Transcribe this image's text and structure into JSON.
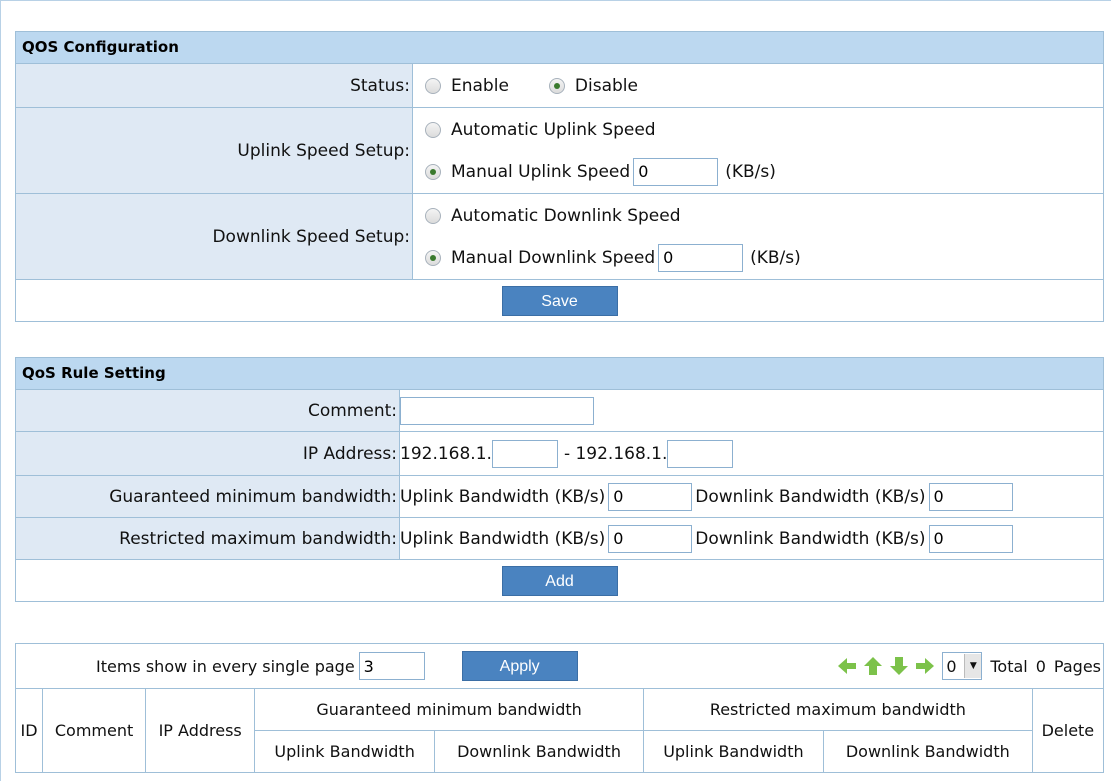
{
  "qos": {
    "title": "QOS Configuration",
    "status_label": "Status:",
    "enable": "Enable",
    "disable": "Disable",
    "uplink_label": "Uplink Speed Setup:",
    "auto_uplink": "Automatic Uplink Speed",
    "manual_uplink": "Manual Uplink Speed",
    "uplink_value": "0",
    "uplink_unit": "(KB/s)",
    "downlink_label": "Downlink Speed Setup:",
    "auto_downlink": "Automatic Downlink Speed",
    "manual_downlink": "Manual Downlink Speed",
    "downlink_value": "0",
    "downlink_unit": "(KB/s)",
    "save": "Save"
  },
  "rule": {
    "title": "QoS Rule Setting",
    "comment_label": "Comment:",
    "comment_value": "",
    "ip_label": "IP Address:",
    "ip_prefix_start": "192.168.1.",
    "ip_sep": "- 192.168.1.",
    "ip_start_value": "",
    "ip_end_value": "",
    "guaranteed_label": "Guaranteed minimum bandwidth:",
    "restricted_label": "Restricted maximum bandwidth:",
    "uplink_bw": "Uplink Bandwidth (KB/s)",
    "downlink_bw": "Downlink Bandwidth (KB/s)",
    "g_up": "0",
    "g_down": "0",
    "r_up": "0",
    "r_down": "0",
    "add": "Add"
  },
  "list": {
    "items_label": "Items show in every single page",
    "items_value": "3",
    "apply": "Apply",
    "page_value": "0",
    "total": "Total",
    "total_count": "0",
    "pages": "Pages",
    "columns": {
      "id": "ID",
      "comment": "Comment",
      "ip": "IP Address",
      "guaranteed": "Guaranteed minimum bandwidth",
      "restricted": "Restricted maximum bandwidth",
      "uplink": "Uplink Bandwidth",
      "downlink": "Downlink Bandwidth",
      "delete": "Delete"
    }
  },
  "colors": {
    "header_bg": "#bcd8f0",
    "label_bg": "#dfe9f4",
    "button_bg": "#4a83c0",
    "nav_arrow": "#7cc24a"
  }
}
